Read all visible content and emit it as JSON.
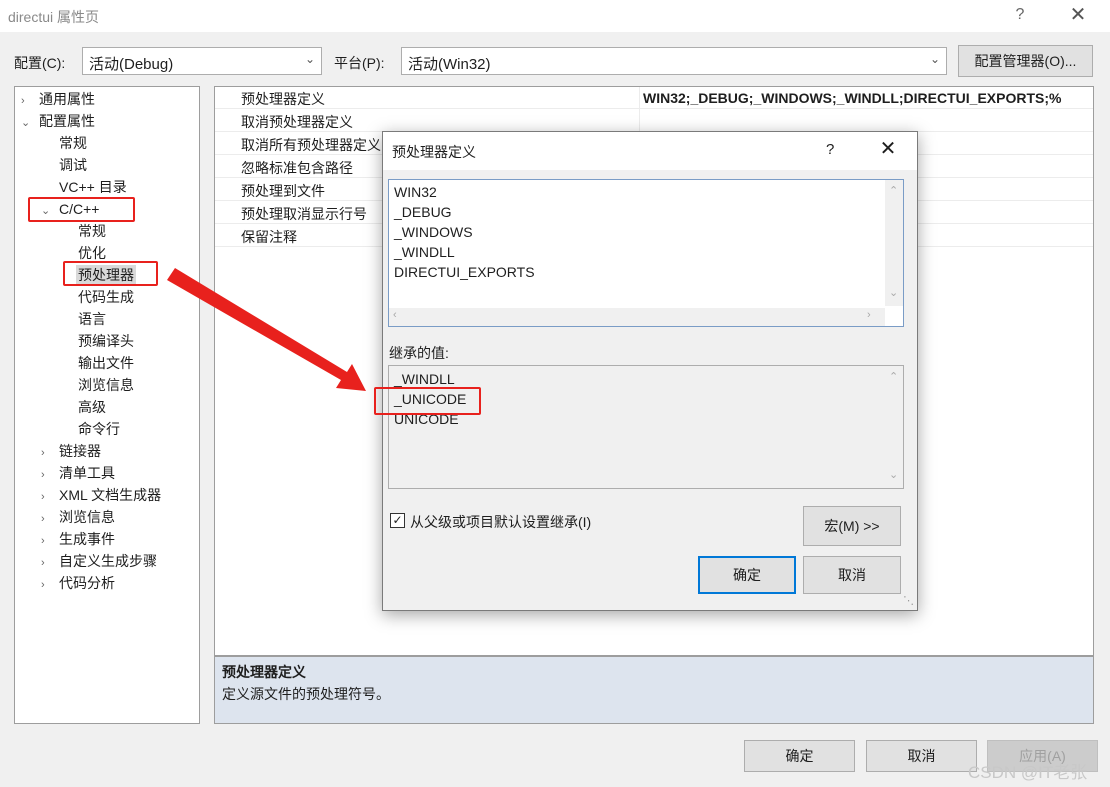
{
  "window": {
    "title": "directui 属性页",
    "help": "?",
    "close": "✕"
  },
  "config": {
    "config_label": "配置(C):",
    "config_value": "活动(Debug)",
    "platform_label": "平台(P):",
    "platform_value": "活动(Win32)",
    "manager_button": "配置管理器(O)..."
  },
  "tree": {
    "items": [
      {
        "label": "通用属性",
        "chevron": "›"
      },
      {
        "label": "配置属性",
        "chevron": "⌄"
      },
      {
        "label": "常规",
        "chevron": ""
      },
      {
        "label": "调试",
        "chevron": ""
      },
      {
        "label": "VC++ 目录",
        "chevron": ""
      },
      {
        "label": "C/C++",
        "chevron": "⌄"
      },
      {
        "label": "常规",
        "chevron": ""
      },
      {
        "label": "优化",
        "chevron": ""
      },
      {
        "label": "预处理器",
        "chevron": ""
      },
      {
        "label": "代码生成",
        "chevron": ""
      },
      {
        "label": "语言",
        "chevron": ""
      },
      {
        "label": "预编译头",
        "chevron": ""
      },
      {
        "label": "输出文件",
        "chevron": ""
      },
      {
        "label": "浏览信息",
        "chevron": ""
      },
      {
        "label": "高级",
        "chevron": ""
      },
      {
        "label": "命令行",
        "chevron": ""
      },
      {
        "label": "链接器",
        "chevron": "›"
      },
      {
        "label": "清单工具",
        "chevron": "›"
      },
      {
        "label": "XML 文档生成器",
        "chevron": "›"
      },
      {
        "label": "浏览信息",
        "chevron": "›"
      },
      {
        "label": "生成事件",
        "chevron": "›"
      },
      {
        "label": "自定义生成步骤",
        "chevron": "›"
      },
      {
        "label": "代码分析",
        "chevron": "›"
      }
    ]
  },
  "properties": {
    "rows": [
      {
        "name": "预处理器定义",
        "value": "WIN32;_DEBUG;_WINDOWS;_WINDLL;DIRECTUI_EXPORTS;%"
      },
      {
        "name": "取消预处理器定义",
        "value": ""
      },
      {
        "name": "取消所有预处理器定义",
        "value": ""
      },
      {
        "name": "忽略标准包含路径",
        "value": ""
      },
      {
        "name": "预处理到文件",
        "value": ""
      },
      {
        "name": "预处理取消显示行号",
        "value": ""
      },
      {
        "name": "保留注释",
        "value": ""
      }
    ]
  },
  "description": {
    "title": "预处理器定义",
    "text": "定义源文件的预处理符号。"
  },
  "buttons": {
    "ok": "确定",
    "cancel": "取消",
    "apply": "应用(A)"
  },
  "watermark": "CSDN @IT老张",
  "dialog": {
    "title": "预处理器定义",
    "help": "?",
    "close": "✕",
    "values": [
      "WIN32",
      "_DEBUG",
      "_WINDOWS",
      "_WINDLL",
      "DIRECTUI_EXPORTS"
    ],
    "inherited_label": "继承的值:",
    "inherited_values": [
      "_WINDLL",
      "_UNICODE",
      "UNICODE"
    ],
    "inherit_checkbox_label": "从父级或项目默认设置继承(I)",
    "inherit_checked": true,
    "macro_button": "宏(M) >>",
    "ok": "确定",
    "cancel": "取消"
  },
  "annotation": {
    "color": "#e8211d"
  }
}
